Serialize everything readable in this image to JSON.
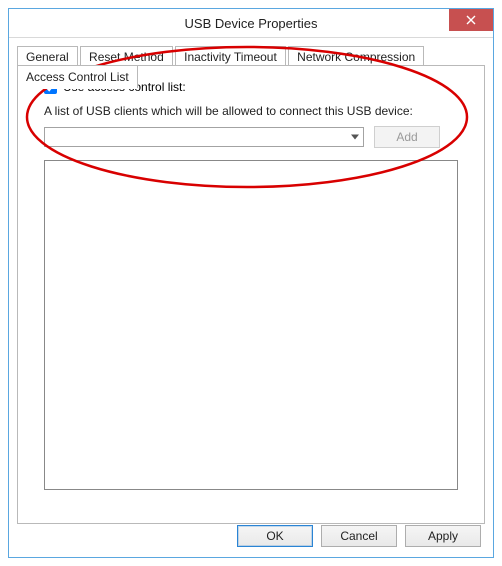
{
  "window": {
    "title": "USB Device Properties"
  },
  "tabs": {
    "t0": "General",
    "t1": "Reset Method",
    "t2": "Inactivity Timeout",
    "t3": "Network Compression",
    "t4": "Access Control List"
  },
  "acl": {
    "checkbox_label": "Use access control list:",
    "description": "A list of USB clients which will be allowed to connect this USB device:",
    "combo_value": "",
    "add_label": "Add"
  },
  "buttons": {
    "ok": "OK",
    "cancel": "Cancel",
    "apply": "Apply"
  }
}
